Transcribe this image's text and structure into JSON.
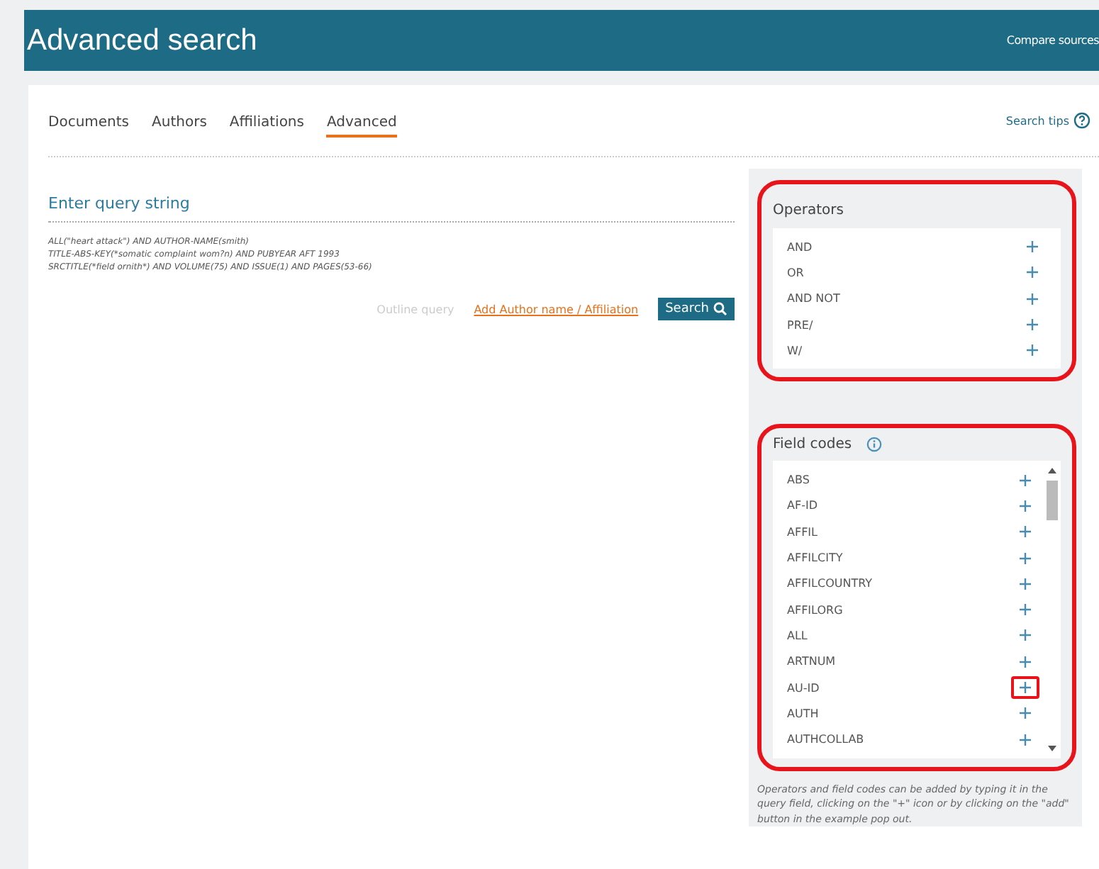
{
  "header": {
    "title": "Advanced search",
    "link": "Compare sources"
  },
  "tabs": [
    {
      "label": "Documents",
      "selected": false
    },
    {
      "label": "Authors",
      "selected": false
    },
    {
      "label": "Affiliations",
      "selected": false
    },
    {
      "label": "Advanced",
      "selected": true
    }
  ],
  "search_tips": "Search tips",
  "query": {
    "placeholder": "Enter query string",
    "examples": [
      "ALL(\"heart attack\") AND AUTHOR-NAME(smith)",
      "TITLE-ABS-KEY(*somatic complaint wom?n) AND PUBYEAR AFT 1993",
      "SRCTITLE(*field ornith*) AND VOLUME(75) AND ISSUE(1) AND PAGES(53-66)"
    ]
  },
  "actions": {
    "outline": "Outline query",
    "add_author": "Add Author name / Affiliation",
    "search": "Search"
  },
  "operators": {
    "title": "Operators",
    "highlighted": true,
    "items": [
      {
        "label": "AND",
        "highlighted": false
      },
      {
        "label": "OR",
        "highlighted": false
      },
      {
        "label": "AND NOT",
        "highlighted": false
      },
      {
        "label": "PRE/",
        "highlighted": false
      },
      {
        "label": "W/",
        "highlighted": false
      }
    ]
  },
  "field_codes": {
    "title": "Field codes",
    "highlighted": true,
    "items": [
      {
        "label": "ABS",
        "highlighted": false
      },
      {
        "label": "AF-ID",
        "highlighted": false
      },
      {
        "label": "AFFIL",
        "highlighted": false
      },
      {
        "label": "AFFILCITY",
        "highlighted": false
      },
      {
        "label": "AFFILCOUNTRY",
        "highlighted": false
      },
      {
        "label": "AFFILORG",
        "highlighted": false
      },
      {
        "label": "ALL",
        "highlighted": false
      },
      {
        "label": "ARTNUM",
        "highlighted": false
      },
      {
        "label": "AU-ID",
        "highlighted": true
      },
      {
        "label": "AUTH",
        "highlighted": false
      },
      {
        "label": "AUTHCOLLAB",
        "highlighted": false
      }
    ]
  },
  "help_text": "Operators and field codes can be added by typing it in the query field, clicking on the \"+\" icon or by clicking on the \"add\" button in the example pop out."
}
